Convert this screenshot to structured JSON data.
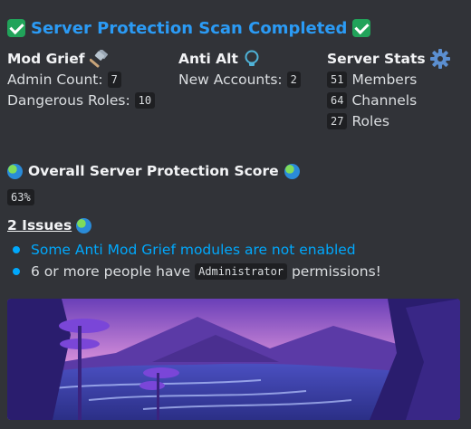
{
  "title": "Server Protection Scan Completed",
  "mod_grief": {
    "heading": "Mod Grief",
    "icon": "hammer-icon",
    "admin_count_label": "Admin Count:",
    "admin_count": "7",
    "dangerous_roles_label": "Dangerous Roles:",
    "dangerous_roles": "10"
  },
  "anti_alt": {
    "heading": "Anti Alt",
    "icon": "lightbulb-icon",
    "new_accounts_label": "New Accounts:",
    "new_accounts": "2"
  },
  "server_stats": {
    "heading": "Server Stats",
    "icon": "gear-icon",
    "members_count": "51",
    "members_label": "Members",
    "channels_count": "64",
    "channels_label": "Channels",
    "roles_count": "27",
    "roles_label": "Roles"
  },
  "score": {
    "heading": "Overall Server Protection Score",
    "icon": "globe-icon",
    "value": "63%"
  },
  "issues": {
    "heading": "2 Issues",
    "icon": "globe-icon",
    "items": [
      {
        "text": "Some Anti Mod Grief modules are not enabled"
      },
      {
        "prefix": "6 or more people have",
        "code": "Administrator",
        "suffix": "permissions!"
      }
    ]
  },
  "colors": {
    "background": "#313338",
    "title_blue": "#2b9bf5",
    "link_blue": "#00a8fc",
    "check_green": "#21a35a"
  }
}
